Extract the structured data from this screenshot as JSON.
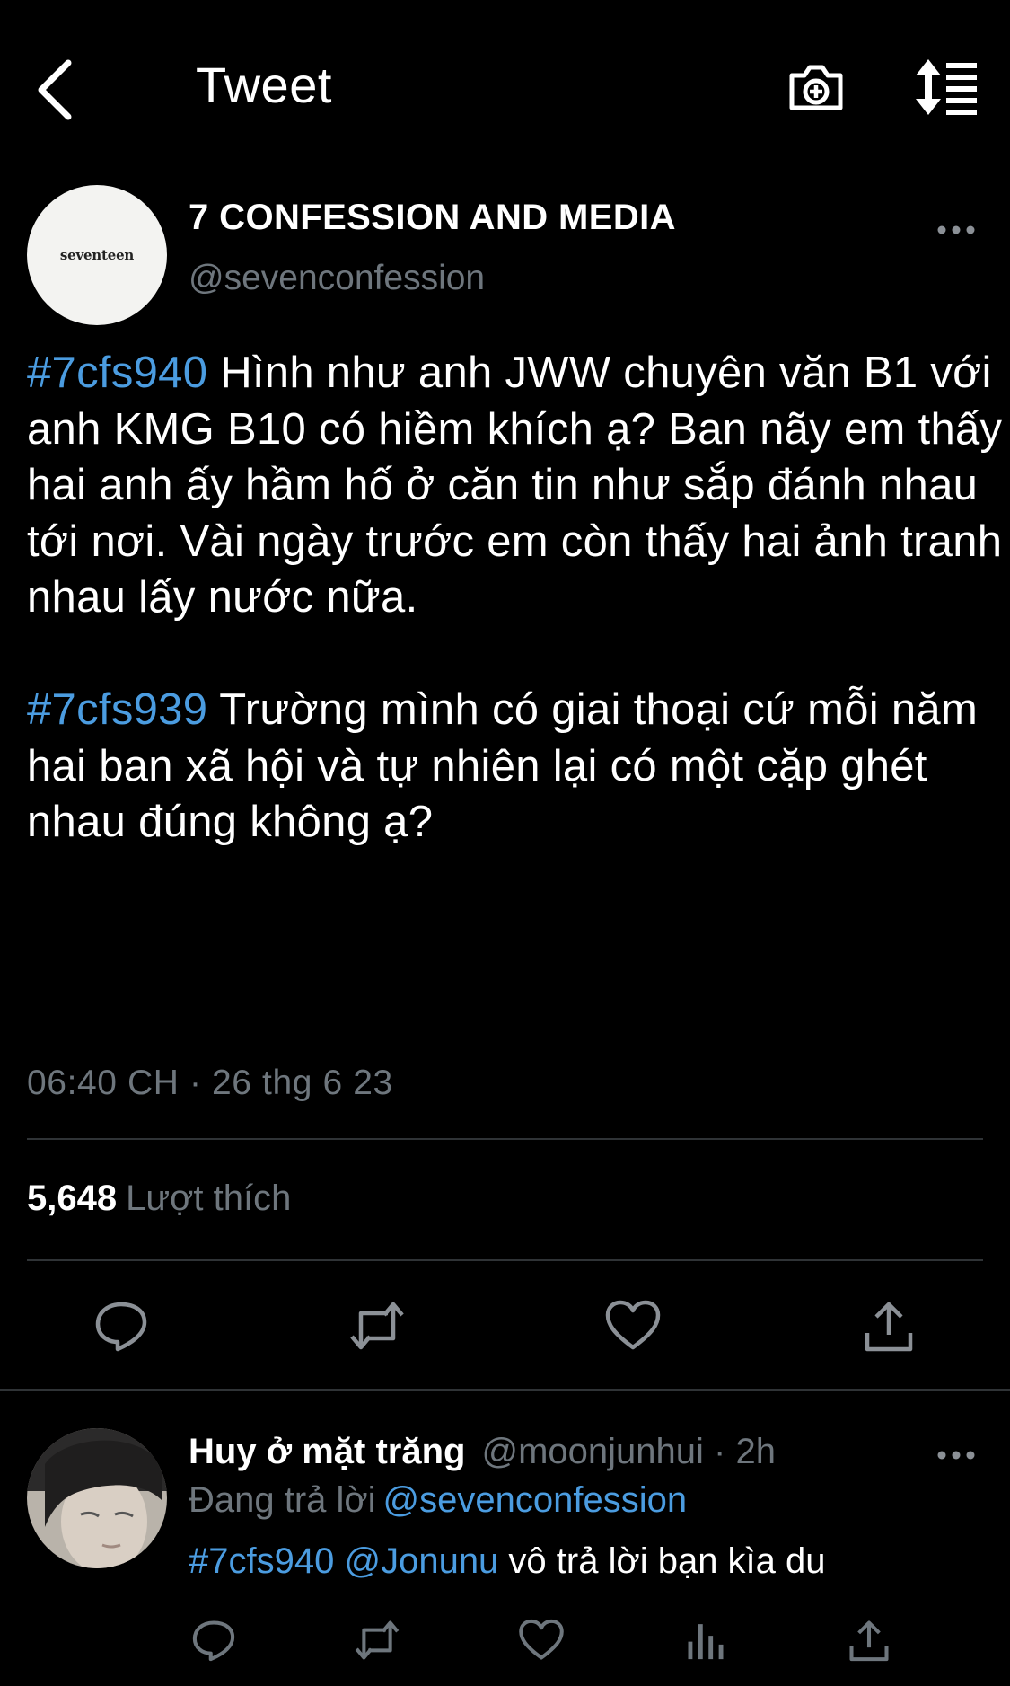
{
  "header": {
    "title": "Tweet",
    "back_icon": "chevron-left-icon",
    "camera_icon": "camera-plus-icon",
    "sort_icon": "sort-lines-icon"
  },
  "tweet": {
    "author_name": "7 CONFESSION AND MEDIA",
    "author_handle": "@sevenconfession",
    "avatar_text": "seventeen",
    "paragraphs": [
      {
        "hashtag": "#7cfs940",
        "text": " Hình như anh JWW chuyên văn B1 với anh KMG B10 có hiềm khích ạ? Ban nãy em thấy hai anh ấy hầm hố ở căn tin như sắp đánh nhau tới nơi. Vài ngày trước em còn thấy hai ảnh tranh nhau lấy nước nữa."
      },
      {
        "hashtag": "#7cfs939",
        "text": " Trường mình có giai thoại cứ mỗi năm hai ban xã hội và tự nhiên lại có một cặp ghét nhau đúng không ạ?"
      }
    ],
    "timestamp": "06:40 CH · 26 thg 6 23",
    "likes_count": "5,648",
    "likes_label": "Lượt thích",
    "actions": [
      "reply-icon",
      "retweet-icon",
      "like-icon",
      "share-icon"
    ]
  },
  "reply": {
    "name": "Huy ở mặt trăng",
    "meta": "@moonjunhui · 2h",
    "replying_label": "Đang trả lời",
    "replying_handle": "@sevenconfession",
    "hashtag": "#7cfs940",
    "mention": "@Jonunu",
    "text": " vô trả lời bạn kìa du",
    "actions": [
      "reply-icon",
      "retweet-icon",
      "like-icon",
      "views-icon",
      "share-icon"
    ]
  },
  "colors": {
    "background": "#000000",
    "text": "#ffffff",
    "muted": "#6e767d",
    "link": "#4b9ce0",
    "divider": "#2f3336"
  }
}
